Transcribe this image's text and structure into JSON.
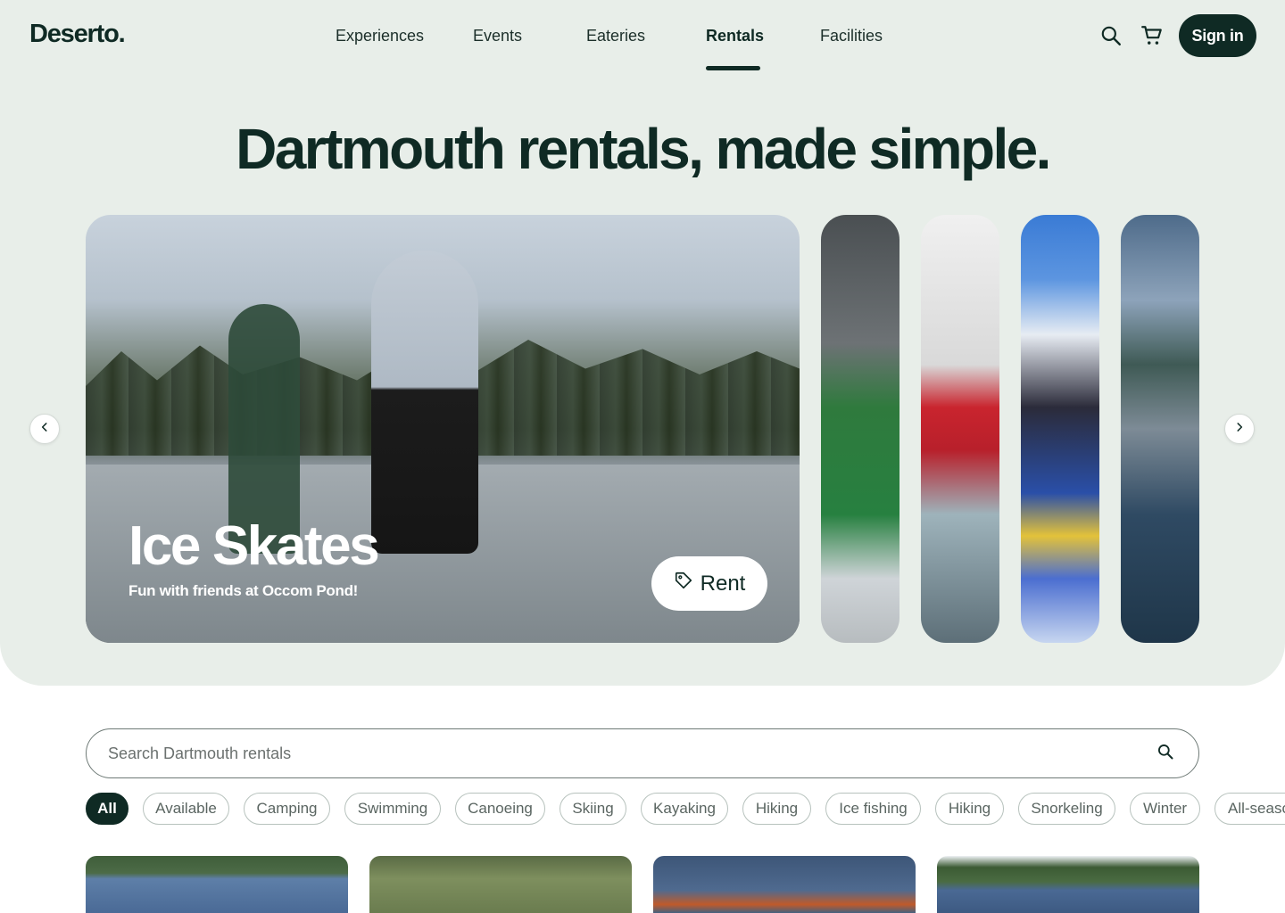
{
  "brand": {
    "logo": "Deserto."
  },
  "nav": {
    "items": [
      {
        "label": "Experiences",
        "active": false
      },
      {
        "label": "Events",
        "active": false
      },
      {
        "label": "Eateries",
        "active": false
      },
      {
        "label": "Rentals",
        "active": true
      },
      {
        "label": "Facilities",
        "active": false
      }
    ]
  },
  "header": {
    "search_icon": "search-icon",
    "cart_icon": "cart-icon",
    "signin_label": "Sign in"
  },
  "hero": {
    "headline": "Dartmouth rentals, made simple.",
    "featured": {
      "title": "Ice Skates",
      "subtitle": "Fun with friends at Occom Pond!",
      "rent_label": "Rent",
      "rent_icon": "tag-icon"
    },
    "thumbnails": [
      "cross-country-skiing",
      "snow-tubing",
      "sledding-group",
      "snowboarding"
    ],
    "prev_icon": "chevron-left-icon",
    "next_icon": "chevron-right-icon"
  },
  "search": {
    "placeholder": "Search Dartmouth rentals",
    "value": "",
    "icon": "search-icon"
  },
  "filters": {
    "chips": [
      "All",
      "Available",
      "Camping",
      "Swimming",
      "Canoeing",
      "Skiing",
      "Kayaking",
      "Hiking",
      "Ice fishing",
      "Hiking",
      "Snorkeling",
      "Winter",
      "All-season"
    ],
    "selected": "All"
  },
  "colors": {
    "brand_dark": "#0f2a24",
    "hero_bg": "#e8eee9",
    "chip_border": "#b7c2bd"
  }
}
